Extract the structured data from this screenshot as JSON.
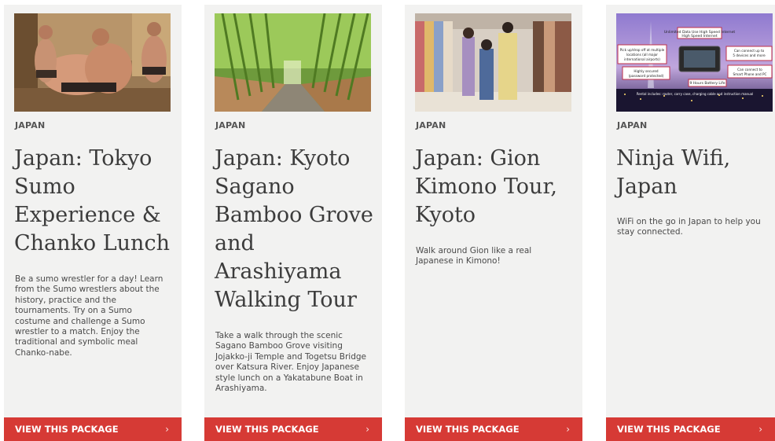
{
  "cards": [
    {
      "image_icon": "sumo-photo",
      "tag": "JAPAN",
      "title": "Japan: Tokyo Sumo Experience & Chanko Lunch",
      "description": "Be a sumo wrestler for a day! Learn from the Sumo wrestlers about the history, practice and the tournaments. Try on a Sumo costume and challenge a Sumo wrestler to a match. Enjoy the traditional and symbolic meal Chanko-nabe.",
      "cta_label": "VIEW THIS PACKAGE",
      "cta_icon": "chevron-right-icon"
    },
    {
      "image_icon": "bamboo-grove-photo",
      "tag": "JAPAN",
      "title": "Japan: Kyoto Sagano Bamboo Grove and Arashiyama Walking Tour",
      "description": "Take a walk through the scenic Sagano Bamboo Grove visiting Jojakko-ji Temple and Togetsu Bridge over Katsura River. Enjoy Japanese style lunch on a Yakatabune Boat in Arashiyama.",
      "cta_label": "VIEW THIS PACKAGE",
      "cta_icon": "chevron-right-icon"
    },
    {
      "image_icon": "kimono-shop-photo",
      "tag": "JAPAN",
      "title": "Japan: Gion Kimono Tour, Kyoto",
      "description": "Walk around Gion like a real Japanese in Kimono!",
      "cta_label": "VIEW THIS PACKAGE",
      "cta_icon": "chevron-right-icon"
    },
    {
      "image_icon": "wifi-router-infographic",
      "image_text": {
        "top": "Unlimited Data Use\nHigh Speed Internet",
        "left1": "Pick up/drop off at multiple locations (all major international airports)",
        "left2": "Highly secured (password protected)",
        "right1": "Can connect up to 5 devices and more",
        "right2": "Can connect to Smart Phone and PC",
        "battery": "9 Hours Battery Life",
        "bottom": "Rental includes: router, carry case, charging cable and instruction manual"
      },
      "tag": "JAPAN",
      "title": "Ninja Wifi, Japan",
      "description": "WiFi on the go in Japan to help you stay connected.",
      "cta_label": "VIEW THIS PACKAGE",
      "cta_icon": "chevron-right-icon"
    }
  ],
  "colors": {
    "card_bg": "#f2f2f1",
    "cta_bg": "#d63a35",
    "cta_text": "#ffffff",
    "title_text": "#3c3c3c"
  }
}
